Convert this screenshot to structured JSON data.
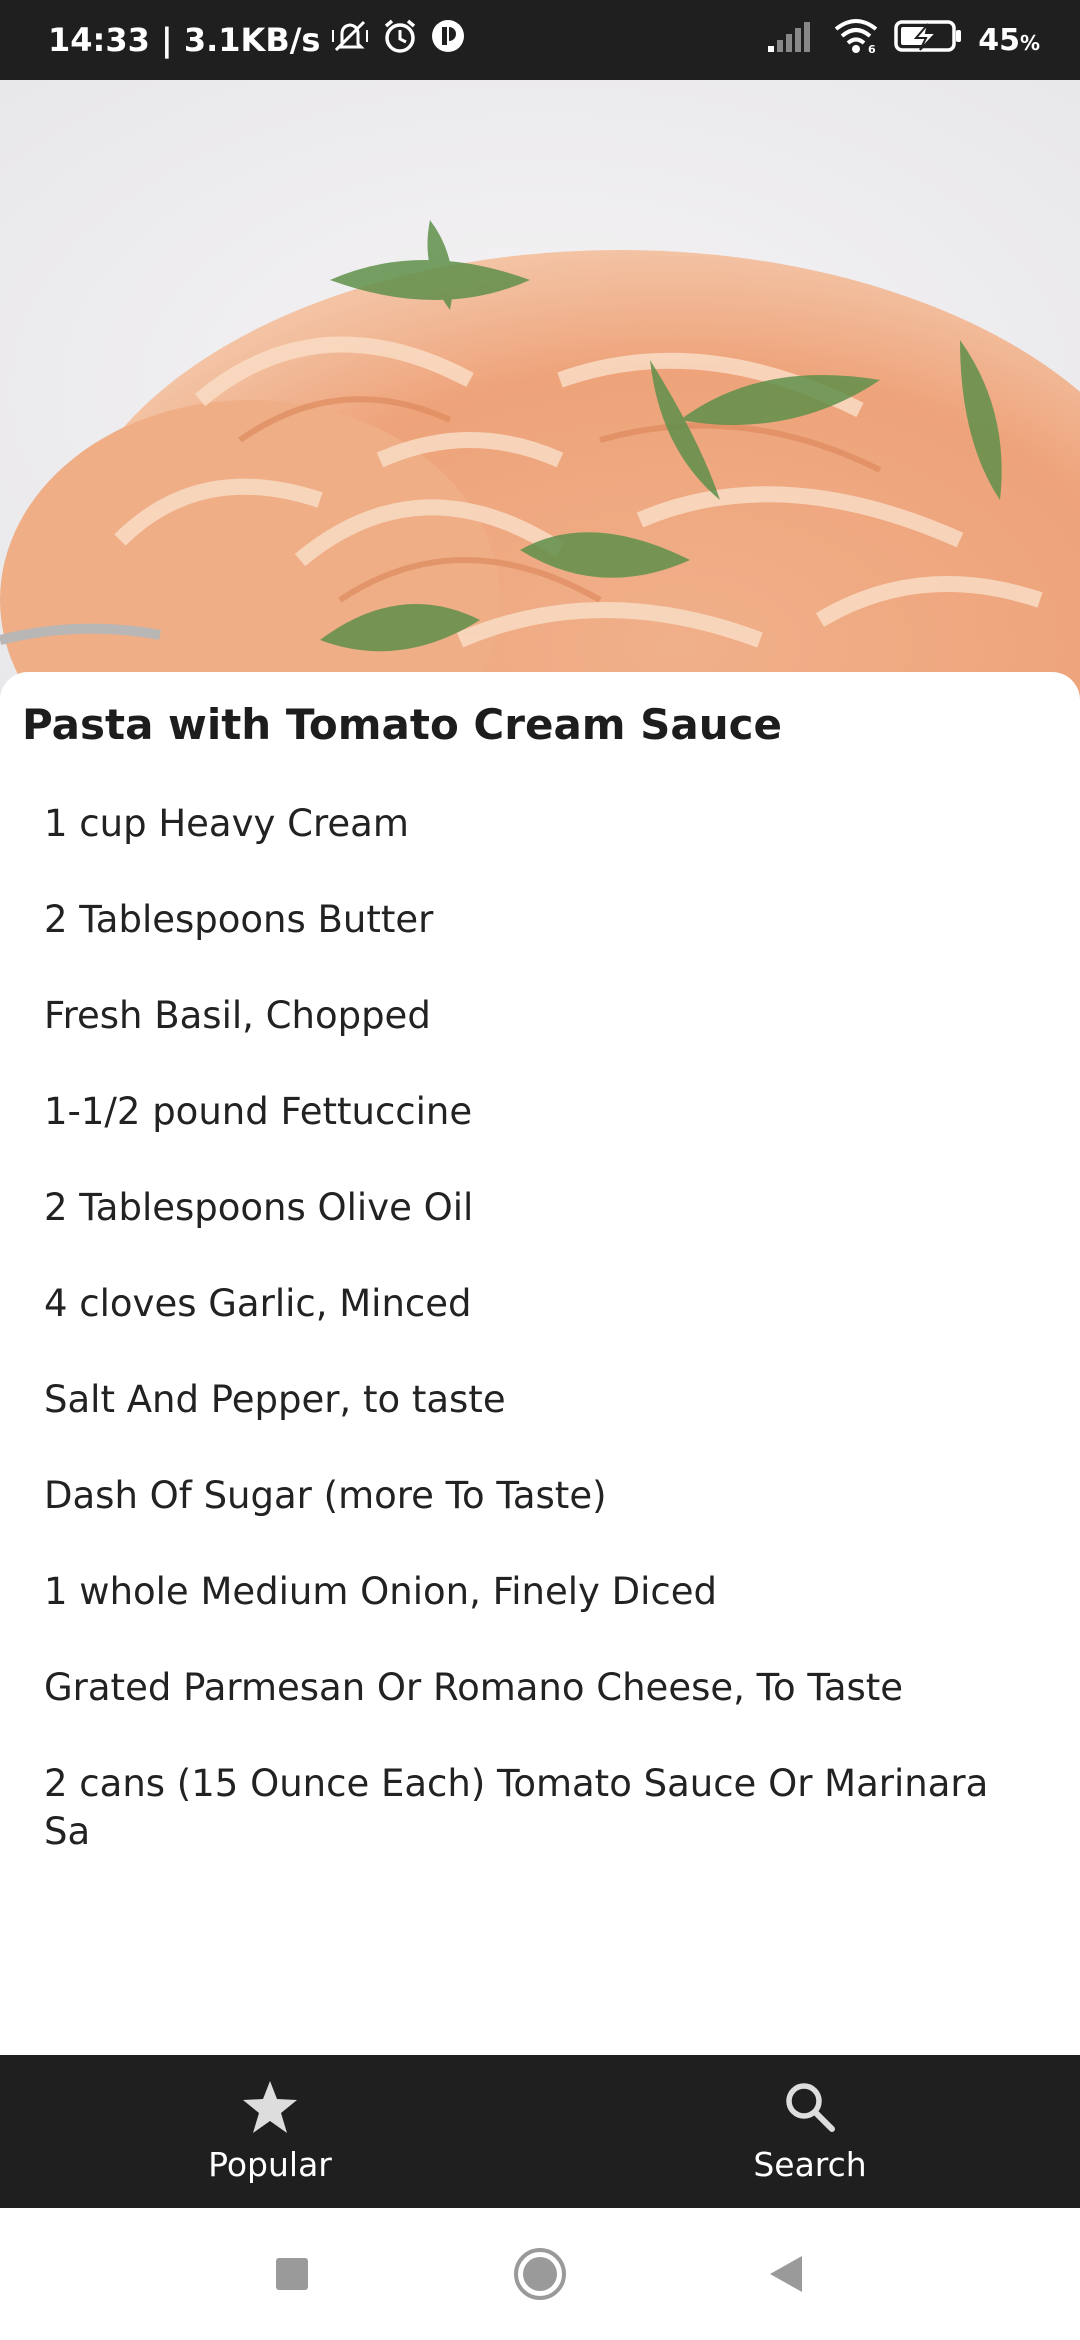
{
  "status_bar": {
    "time_speed": "14:33 | 3.1KB/s",
    "battery_percent": "45",
    "battery_percent_sign": "%",
    "icons": [
      "mute-vibrate-icon",
      "alarm-icon",
      "app-notification-icon",
      "signal-icon",
      "wifi-icon",
      "battery-charging-icon"
    ]
  },
  "hero": {
    "image": "pasta-photo",
    "description_icon": "pasta-image"
  },
  "recipe": {
    "title": "Pasta with Tomato Cream Sauce",
    "ingredients": [
      "1 cup Heavy Cream",
      "2 Tablespoons Butter",
      "Fresh Basil, Chopped",
      "1-1/2 pound Fettuccine",
      "2 Tablespoons Olive Oil",
      "4 cloves Garlic, Minced",
      "Salt And Pepper, to taste",
      "Dash Of Sugar (more To Taste)",
      "1 whole Medium Onion, Finely Diced",
      "Grated Parmesan Or Romano Cheese, To Taste",
      "2 cans (15 Ounce Each) Tomato Sauce Or Marinara Sa"
    ]
  },
  "bottom_nav": {
    "items": [
      {
        "label": "Popular",
        "icon": "star-icon"
      },
      {
        "label": "Search",
        "icon": "search-icon"
      }
    ]
  },
  "system_nav": {
    "buttons": [
      "recents-button",
      "home-button",
      "back-button"
    ]
  },
  "colors": {
    "bar_background": "#1f1f1f",
    "text_primary": "#222222",
    "background": "#ffffff"
  }
}
